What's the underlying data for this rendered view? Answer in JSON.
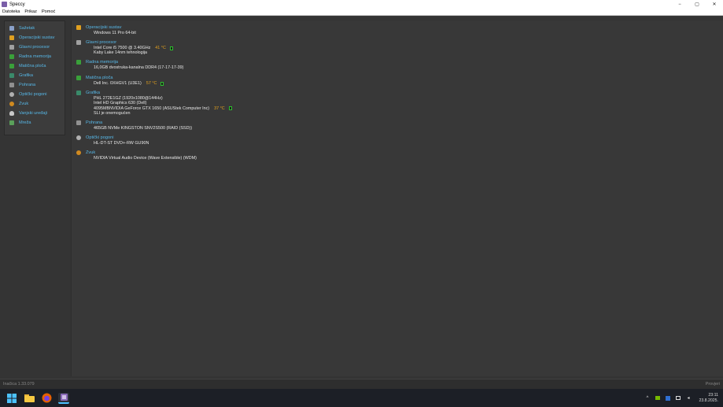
{
  "window": {
    "title": "Speccy",
    "minimize": "−",
    "maximize": "▢",
    "close": "✕"
  },
  "menu": [
    "Datoteka",
    "Prikaz",
    "Pomoć"
  ],
  "sidebar": {
    "items": [
      {
        "label": "Sažetak",
        "icon": "summary-icon",
        "color": "#8aa0c8"
      },
      {
        "label": "Operacijski sustav",
        "icon": "windows-icon",
        "color": "#e0a020"
      },
      {
        "label": "Glavni procesor",
        "icon": "cpu-icon",
        "color": "#a0a0a0"
      },
      {
        "label": "Radna memorija",
        "icon": "ram-icon",
        "color": "#3aa03a"
      },
      {
        "label": "Matična ploča",
        "icon": "motherboard-icon",
        "color": "#3aa03a"
      },
      {
        "label": "Grafika",
        "icon": "monitor-icon",
        "color": "#3a8a6a"
      },
      {
        "label": "Pohrana",
        "icon": "storage-icon",
        "color": "#909090"
      },
      {
        "label": "Optički pogoni",
        "icon": "disc-icon",
        "color": "#b0b0b0"
      },
      {
        "label": "Zvuk",
        "icon": "speaker-icon",
        "color": "#d08a20"
      },
      {
        "label": "Vanjski uređaji",
        "icon": "mouse-icon",
        "color": "#c8c8c8"
      },
      {
        "label": "Mreža",
        "icon": "network-icon",
        "color": "#5aa05a"
      }
    ]
  },
  "summary": {
    "os": {
      "title": "Operacijski sustav",
      "lines": [
        "Windows 11 Pro 64-bit"
      ]
    },
    "cpu": {
      "title": "Glavni procesor",
      "line1": "Intel Core i5 7500 @ 3.40GHz",
      "temp": "41 °C",
      "line2": "Kaby Lake 14nm tehnologija"
    },
    "ram": {
      "title": "Radna memorija",
      "lines": [
        "16,0GB dvostruka-kanalna DDR4 (17-17-17-39)"
      ]
    },
    "mb": {
      "title": "Matična ploča",
      "line1": "Dell Inc. 0XHGV1 (U3E1)",
      "temp": "57 °C"
    },
    "gpu": {
      "title": "Grafika",
      "line1": "PHL 272E1GZ (1920x1080@144Hz)",
      "line2": "Intel HD Graphics 630 (Dell)",
      "line3": "4095MBNVIDIA GeForce GTX 1650 (ASUStek Computer Inc)",
      "temp": "37 °C",
      "line4": "SLI je onemogućen"
    },
    "storage": {
      "title": "Pohrana",
      "lines": [
        "465GB NVMe KINGSTON SNV2S500 (RAID (SSD))"
      ]
    },
    "optical": {
      "title": "Optički pogoni",
      "lines": [
        "HL-DT-ST DVD+-RW GU90N"
      ]
    },
    "audio": {
      "title": "Zvuk",
      "lines": [
        "NVIDIA Virtual Audio Device (Wave Extensible) (WDM)"
      ]
    }
  },
  "status": {
    "version": "Inačica 1.33.079",
    "update": "Provjeri"
  },
  "taskbar": {
    "time": "23:11",
    "date": "23.8.2025."
  }
}
